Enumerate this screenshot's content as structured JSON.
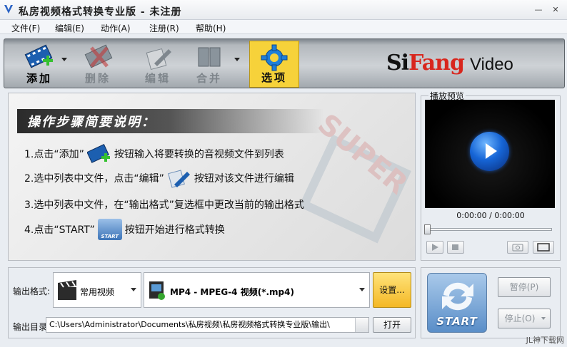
{
  "window": {
    "title": "私房视频格式转换专业版 - 未注册",
    "minimize": "—",
    "close": "✕"
  },
  "menu": [
    {
      "label": "文件(F)"
    },
    {
      "label": "编辑(E)"
    },
    {
      "label": "动作(A)"
    },
    {
      "label": "注册(R)"
    },
    {
      "label": "帮助(H)"
    }
  ],
  "toolbar": {
    "add": "添加",
    "delete": "删除",
    "edit": "编辑",
    "merge": "合并",
    "options": "选项"
  },
  "logo": {
    "part1": "Si",
    "part2": "Fang",
    "part3": "Video"
  },
  "steps": {
    "title": "操作步骤简要说明：",
    "step1_a": "1.点击“添加”",
    "step1_b": "按钮输入将要转换的音视频文件到列表",
    "step2_a": "2.选中列表中文件，点击“编辑”",
    "step2_b": "按钮对该文件进行编辑",
    "step3": "3.选中列表中文件，在“输出格式”复选框中更改当前的输出格式",
    "step4_a": "4.点击“START”",
    "step4_b": "按钮开始进行格式转换",
    "start_icon_label": "START",
    "watermark": "SUPER"
  },
  "preview": {
    "label": "播放预览",
    "time": "0:00:00 / 0:00:00"
  },
  "output": {
    "format_label": "输出格式:",
    "category": "常用视频",
    "format": "MP4 - MPEG-4 视频(*.mp4)",
    "settings": "设置...",
    "dir_label": "输出目录:",
    "dir_path": "C:\\Users\\Administrator\\Documents\\私房视频\\私房视频格式转换专业版\\输出\\",
    "open": "打开"
  },
  "controls": {
    "start": "START",
    "pause": "暂停(P)",
    "stop": "停止(O)"
  },
  "corner_watermark": "JL神下载网"
}
